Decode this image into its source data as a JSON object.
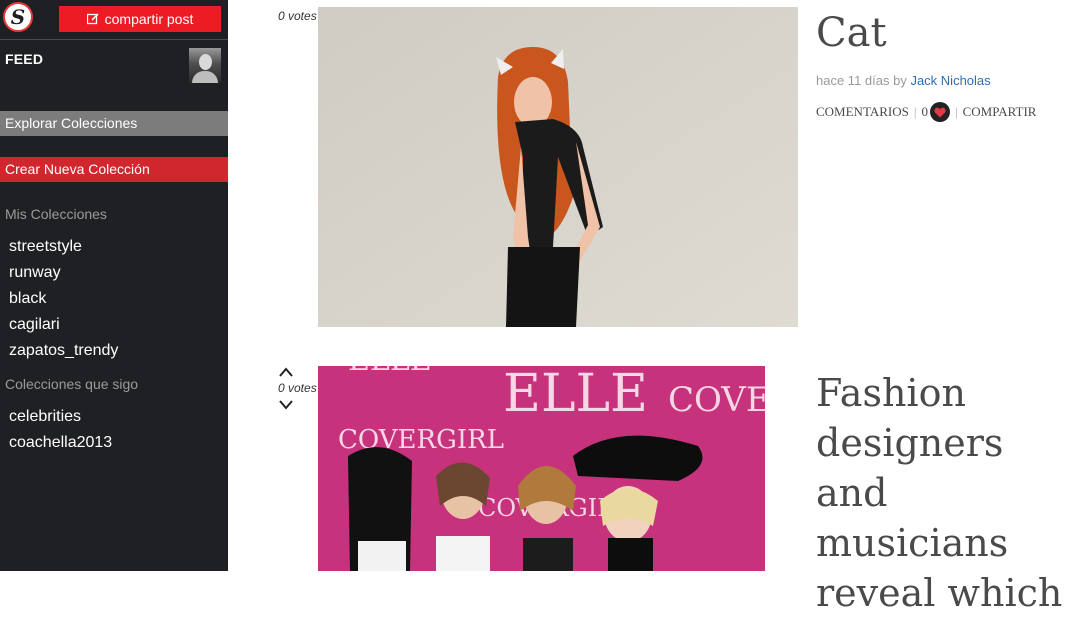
{
  "sidebar": {
    "logo_letter": "S",
    "share_button": "compartir post",
    "feed_label": "FEED",
    "explore_label": "Explorar Colecciones",
    "create_label": "Crear Nueva Colección",
    "my_collections_title": "Mis Colecciones",
    "my_collections": [
      "streetstyle",
      "runway",
      "black",
      "cagilari",
      "zapatos_trendy"
    ],
    "following_title": "Colecciones que sigo",
    "following": [
      "celebrities",
      "coachella2013"
    ]
  },
  "posts": [
    {
      "votes": "0 votes",
      "title": "Cat",
      "time": "hace 11 días by",
      "author": "Jack Nicholas",
      "comments": "COMENTARIOS",
      "likes": "0",
      "share": "COMPARTIR"
    },
    {
      "votes": "0 votes",
      "title_lines": [
        "Fashion",
        "designers and",
        "musicians",
        "reveal which"
      ],
      "backdrop_words": [
        "ELLE",
        "COVERGIRL",
        "COVE",
        "ELLE",
        "COVERGIRL"
      ]
    }
  ],
  "colors": {
    "sidebar_bg": "#1f2024",
    "share_red": "#ed1b24",
    "create_red": "#d0262e",
    "explore_gray": "#7c7c7c",
    "link_blue": "#2d6db5"
  }
}
